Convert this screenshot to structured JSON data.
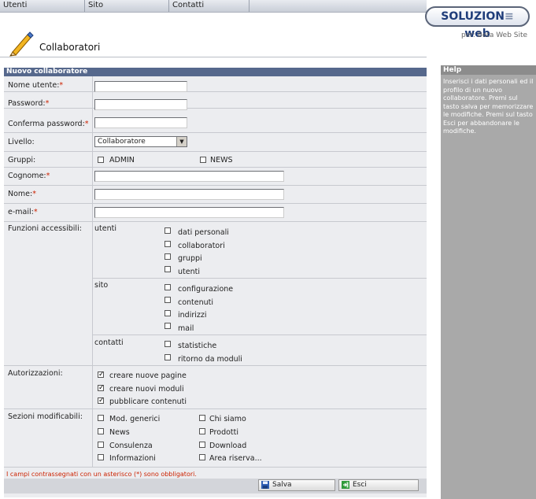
{
  "menu": {
    "items": [
      "Utenti",
      "Sito",
      "Contatti"
    ]
  },
  "brand": {
    "logo_a": "SOLUZION",
    "logo_b": "web",
    "subtitle": "per: Beta Web Site"
  },
  "page": {
    "title": "Collaboratori"
  },
  "form": {
    "header": "Nuovo collaboratore",
    "required_mark": "*",
    "fields": {
      "username": {
        "label": "Nome utente:",
        "value": ""
      },
      "password": {
        "label": "Password:",
        "value": ""
      },
      "confirm": {
        "label": "Conferma password:",
        "value": ""
      },
      "level": {
        "label": "Livello:",
        "value": "Collaboratore"
      },
      "groups": {
        "label": "Gruppi:",
        "options": [
          "ADMIN",
          "NEWS"
        ]
      },
      "surname": {
        "label": "Cognome:",
        "value": ""
      },
      "name": {
        "label": "Nome:",
        "value": ""
      },
      "email": {
        "label": "e-mail:",
        "value": ""
      }
    },
    "functions": {
      "label": "Funzioni accessibili:",
      "groups": [
        {
          "name": "utenti",
          "items": [
            "dati personali",
            "collaboratori",
            "gruppi",
            "utenti"
          ]
        },
        {
          "name": "sito",
          "items": [
            "configurazione",
            "contenuti",
            "indirizzi",
            "mail"
          ]
        },
        {
          "name": "contatti",
          "items": [
            "statistiche",
            "ritorno da moduli"
          ]
        }
      ]
    },
    "authorizations": {
      "label": "Autorizzazioni:",
      "items": [
        {
          "label": "creare nuove pagine",
          "checked": true
        },
        {
          "label": "creare nuovi moduli",
          "checked": true
        },
        {
          "label": "pubblicare contenuti",
          "checked": true
        }
      ]
    },
    "sections": {
      "label": "Sezioni modificabili:",
      "col1": [
        "Mod. generici",
        "News",
        "Consulenza",
        "Informazioni"
      ],
      "col2": [
        "Chi siamo",
        "Prodotti",
        "Download",
        "Area riserva..."
      ]
    },
    "note": "I campi contrassegnati con un asterisco (*) sono obbligatori.",
    "buttons": {
      "save": "Salva",
      "exit": "Esci"
    }
  },
  "help": {
    "title": "Help",
    "text": "Inserisci i dati personali ed il profilo di un nuovo collaboratore. Premi sul tasto salva per memorizzare le modifiche. Premi sul tasto Esci per abbandonare le modifiche."
  },
  "colors": {
    "form_header": "#56688c",
    "help_panel": "#a9a9a9",
    "required": "#cc2200"
  },
  "icons": {
    "page": "pencil-icon",
    "save": "floppy-disk-icon",
    "exit": "exit-icon",
    "select": "chevron-down-icon"
  }
}
